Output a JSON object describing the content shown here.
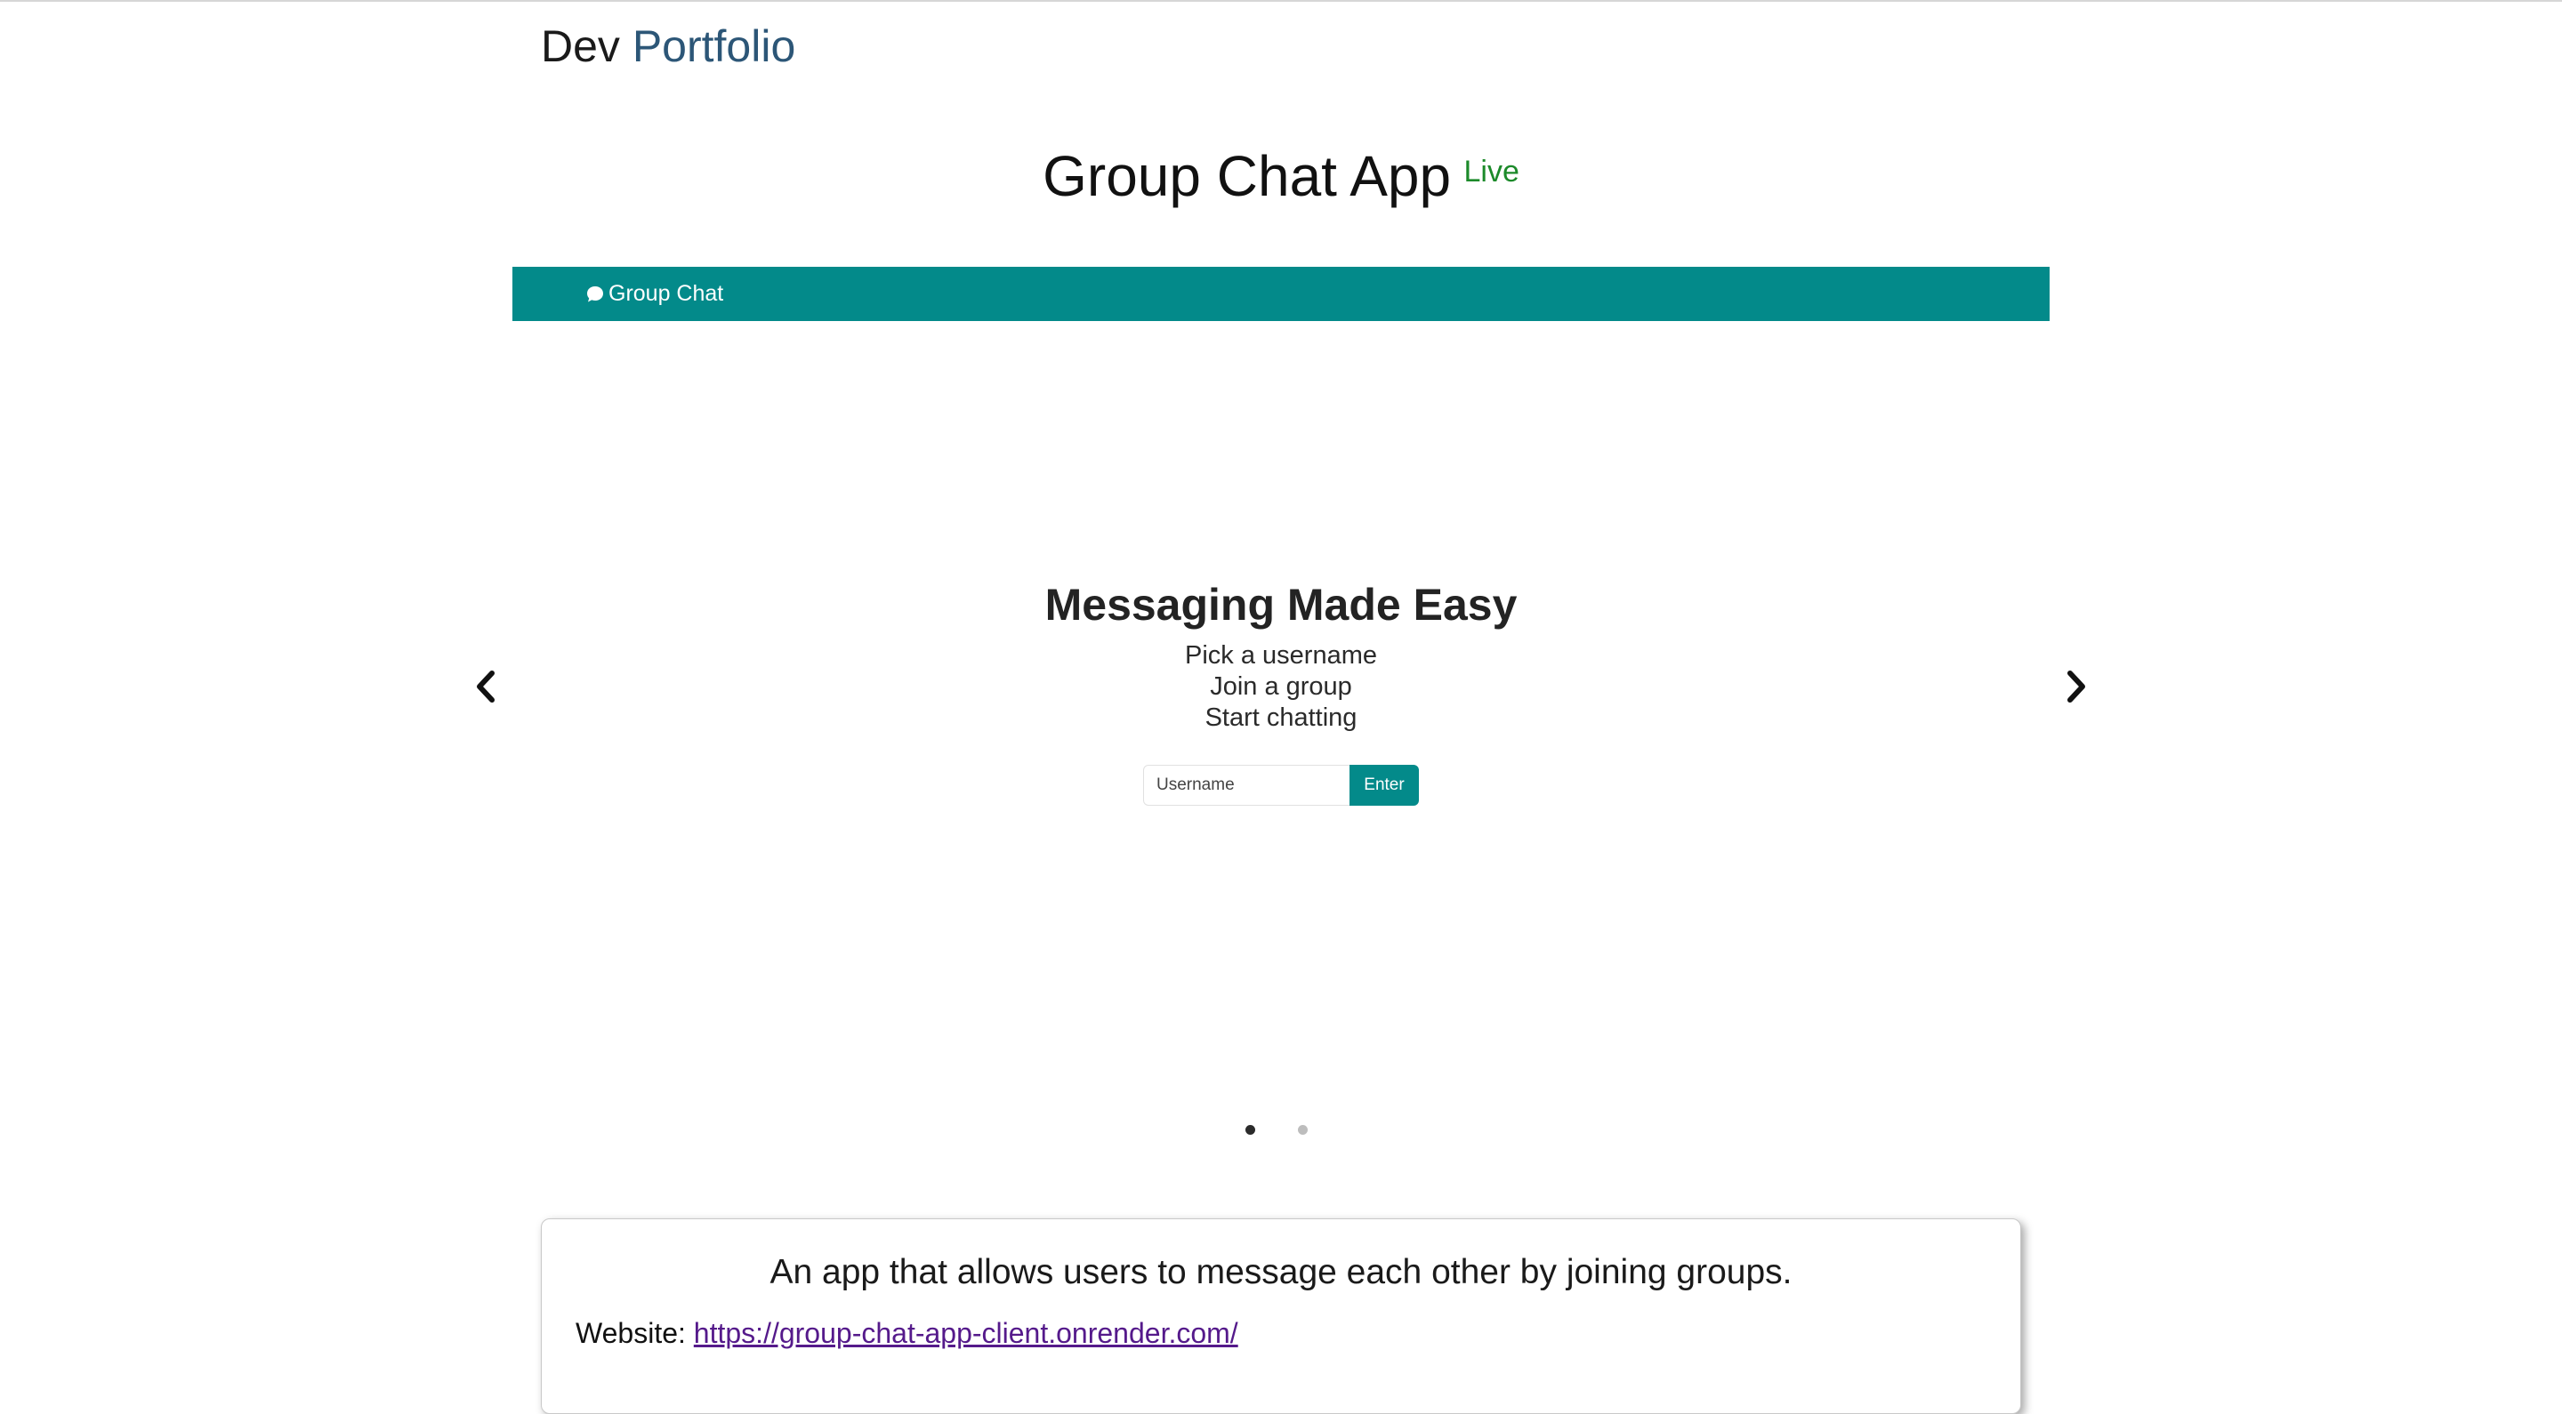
{
  "brand": {
    "first": "Dev",
    "second": "Portfolio"
  },
  "project": {
    "title": "Group Chat App",
    "status_badge": "Live"
  },
  "preview": {
    "nav": {
      "icon": "chat-bubble-icon",
      "label": "Group Chat"
    },
    "hero": {
      "heading": "Messaging Made Easy",
      "lines": [
        "Pick a username",
        "Join a group",
        "Start chatting"
      ]
    },
    "form": {
      "username_placeholder": "Username",
      "submit_label": "Enter"
    },
    "carousel": {
      "prev_icon": "chevron-left-icon",
      "next_icon": "chevron-right-icon",
      "slide_count": 2,
      "active_slide": 1
    }
  },
  "details": {
    "description": "An app that allows users to message each other by joining groups.",
    "website_label": "Website:",
    "website_url": "https://group-chat-app-client.onrender.com/"
  },
  "colors": {
    "accent": "#038a8a",
    "live": "#1c8a2a",
    "brand_second": "#2c5677",
    "link": "#551a8b"
  }
}
